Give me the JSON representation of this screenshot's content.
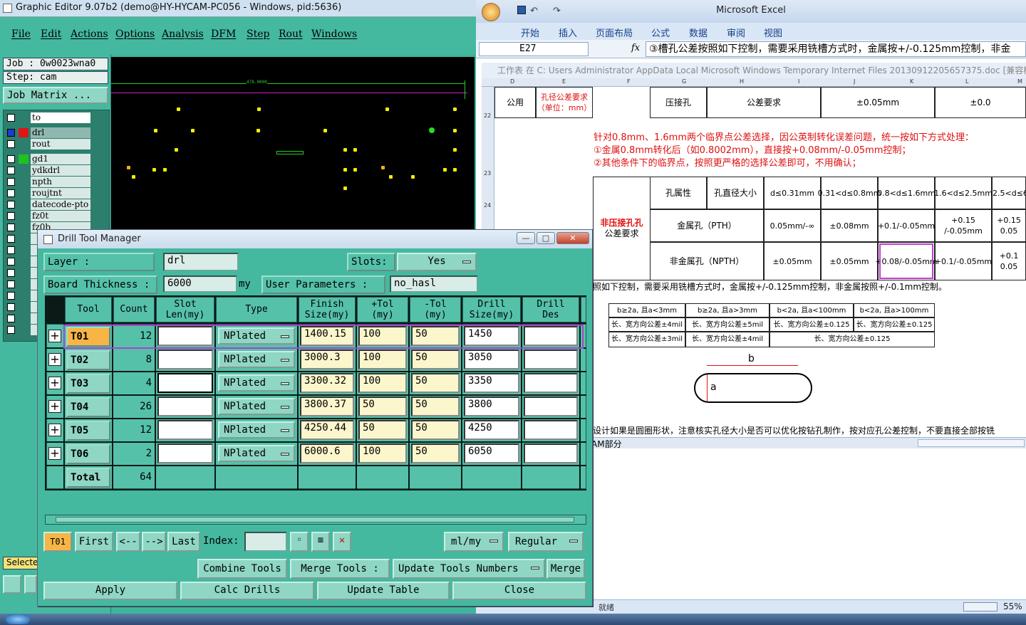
{
  "graphic_editor": {
    "title": "Graphic Editor 9.07b2 (demo@HY-HYCAM-PC056 - Windows, pid:5636)",
    "menu": [
      "File",
      "Edit",
      "Actions",
      "Options",
      "Analysis",
      "DFM",
      "Step",
      "Rout",
      "Windows"
    ],
    "job_label": "Job  : 0w0023wna0",
    "step_label": "Step: cam",
    "job_matrix": "Job Matrix ...",
    "layers": [
      "to",
      "drl",
      "rout",
      "gd1",
      "ydkdrl",
      "npth",
      "roujtnt",
      "datecode-pto",
      "fz0t",
      "fz0b"
    ],
    "dimension": "478.0000",
    "selected_label": "Selecte"
  },
  "drill_tool_manager": {
    "title": "Drill Tool Manager",
    "layer_label": "Layer            :",
    "layer_value": "drl",
    "slots_label": "Slots:",
    "slots_value": "Yes",
    "board_thickness_label": "Board Thickness :",
    "board_thickness_value": "6000",
    "board_thickness_unit": "my",
    "user_params_label": "User Parameters  :",
    "user_params_value": "no_hasl",
    "columns": [
      "Tool",
      "Count",
      "Slot Len(my)",
      "Type",
      "Finish Size(my)",
      "+Tol (my)",
      "-Tol (my)",
      "Drill Size(my)",
      "Drill Des"
    ],
    "rows": [
      {
        "tool": "T01",
        "count": "12",
        "slot_len": "",
        "type": "NPlated",
        "finish": "1400.15",
        "ptol": "100",
        "ntol": "50",
        "drill": "1450",
        "des": ""
      },
      {
        "tool": "T02",
        "count": "8",
        "slot_len": "",
        "type": "NPlated",
        "finish": "3000.3",
        "ptol": "100",
        "ntol": "50",
        "drill": "3050",
        "des": ""
      },
      {
        "tool": "T03",
        "count": "4",
        "slot_len": "",
        "type": "NPlated",
        "finish": "3300.32",
        "ptol": "100",
        "ntol": "50",
        "drill": "3350",
        "des": ""
      },
      {
        "tool": "T04",
        "count": "26",
        "slot_len": "",
        "type": "NPlated",
        "finish": "3800.37",
        "ptol": "50",
        "ntol": "50",
        "drill": "3800",
        "des": ""
      },
      {
        "tool": "T05",
        "count": "12",
        "slot_len": "",
        "type": "NPlated",
        "finish": "4250.44",
        "ptol": "50",
        "ntol": "50",
        "drill": "4250",
        "des": ""
      },
      {
        "tool": "T06",
        "count": "2",
        "slot_len": "",
        "type": "NPlated",
        "finish": "6000.6",
        "ptol": "100",
        "ntol": "50",
        "drill": "6050",
        "des": ""
      }
    ],
    "total_label": "Total",
    "total_count": "64",
    "current_tool": "T01",
    "nav": {
      "first": "First",
      "prev": "<--",
      "next": "-->",
      "last": "Last",
      "index": "Index:"
    },
    "units": "ml/my",
    "mode": "Regular",
    "combine": "Combine Tools",
    "merge_tools": "Merge Tools :",
    "update_numbers": "Update Tools Numbers",
    "merge": "Merge",
    "apply": "Apply",
    "calc": "Calc Drills",
    "update_table": "Update Table",
    "close": "Close"
  },
  "excel": {
    "title": "Microsoft Excel",
    "tabs": [
      "开始",
      "插入",
      "页面布局",
      "公式",
      "数据",
      "审阅",
      "视图"
    ],
    "name_box": "E27",
    "formula": "③槽孔公差按照如下控制，需要采用铣槽方式时，金属按+/-0.125mm控制，非金",
    "doc_path": "工作表 在 C: Users Administrator AppData Local Microsoft Windows Temporary Internet Files 20130912205657375.doc [兼容模式]",
    "col_letters": [
      "D",
      "E",
      "F",
      "G",
      "H",
      "I",
      "J",
      "K",
      "L",
      "M"
    ],
    "row_numbers": [
      "22",
      "23",
      "24"
    ],
    "r1": {
      "gongyong": "公用",
      "hole_req": "孔径公差要求（单位：mm）",
      "press": "压接孔",
      "tol_req": "公差要求",
      "v1": "±0.05mm",
      "v2": "±0.0"
    },
    "note1": "针对0.8mm、1.6mm两个临界点公差选择，因公英制转化误差问题，统一按如下方式处理：",
    "note2": "①金属0.8mm转化后（如0.8002mm），直接按+0.08mm/-0.05mm控制；",
    "note3": "②其他条件下的临界点，按照更严格的选择公差即可，不用确认；",
    "np_title": "非压接孔孔",
    "np_sub": "公差要求",
    "hdr": [
      "孔属性",
      "孔直径大小",
      "d≤0.31mm",
      "0.31<d≤0.8mm",
      "0.8<d≤1.6mm",
      "1.6<d≤2.5mm",
      "2.5<d≤6.0m"
    ],
    "pth": [
      "金属孔（PTH）",
      "0.05mm/-∞",
      "±0.08mm",
      "+0.1/-0.05mm",
      "+0.15 /-0.05mm",
      "+0.15 0.05"
    ],
    "npth": [
      "非金属孔（NPTH）",
      "±0.05mm",
      "±0.05mm",
      "+0.08/-0.05mm",
      "+0.1/-0.05mm",
      "+0.1 0.05"
    ],
    "note4": "照如下控制，需要采用铣槽方式时，金属按+/-0.125mm控制，非金属按照+/-0.1mm控制。",
    "slot_tbl": [
      [
        "b≥2a, 且a<3mm",
        "b≥2a, 且a>3mm",
        "b<2a, 且a<100mm",
        "b<2a, 且a>100mm"
      ],
      [
        "长、宽方向公差±4mil",
        "长、宽方向公差±5mil",
        "长、宽方向公差±0.125",
        "长、宽方向公差±0.125"
      ],
      [
        "长、宽方向公差±3mil",
        "长、宽方向公差±4mil",
        "长、宽方向公差±0.125"
      ]
    ],
    "fig_b": "b",
    "fig_a": "a",
    "note5": "设计如果是圆圈形状，注意核实孔径大小是否可以优化按钻孔制作，按对应孔公差控制，不要直接全部按铣",
    "sheet_tab": "AM部分",
    "status_left": "就绪",
    "zoom": "55%"
  }
}
